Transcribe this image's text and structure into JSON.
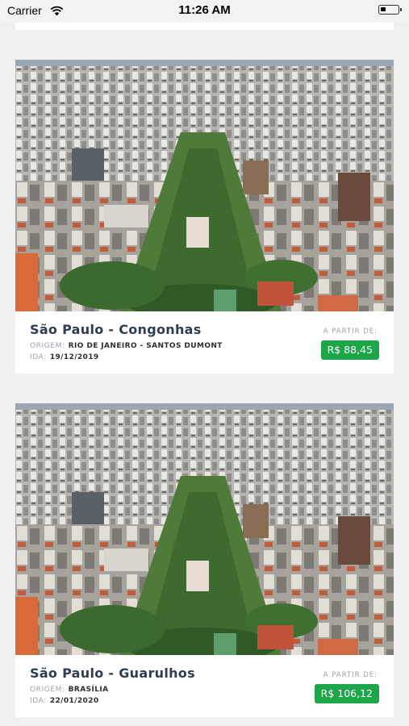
{
  "status_bar": {
    "carrier": "Carrier",
    "time": "11:26 AM",
    "icons": [
      "wifi-icon",
      "battery-icon"
    ]
  },
  "offers": [
    {
      "route": "São Paulo - Congonhas",
      "origin_label": "ORIGEM:",
      "origin": "RIO DE JANEIRO - SANTOS DUMONT",
      "date_label": "IDA:",
      "date": "19/12/2019",
      "from_label": "A PARTIR DE:",
      "price": "R$ 88,45"
    },
    {
      "route": "São Paulo - Guarulhos",
      "origin_label": "ORIGEM:",
      "origin": "BRASÍLIA",
      "date_label": "IDA:",
      "date": "22/01/2020",
      "from_label": "A PARTIR DE:",
      "price": "R$ 106,12"
    }
  ],
  "colors": {
    "price_button": "#1da54a",
    "route_title": "#2e3e52",
    "background": "#f0f0f0"
  }
}
